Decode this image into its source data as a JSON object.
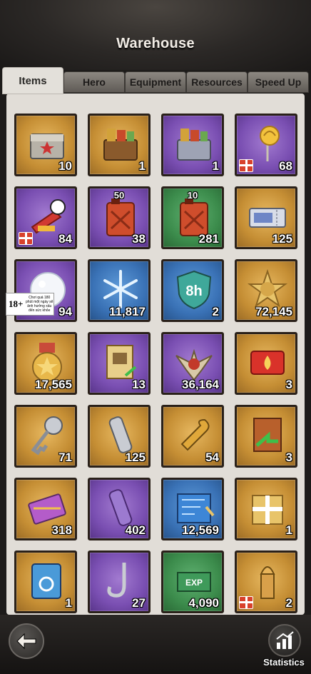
{
  "window": {
    "title": "Warehouse"
  },
  "tabs": [
    {
      "label": "Items",
      "active": true
    },
    {
      "label": "Hero",
      "active": false
    },
    {
      "label": "Equipment",
      "active": false
    },
    {
      "label": "Resources",
      "active": false
    },
    {
      "label": "Speed Up",
      "active": false
    }
  ],
  "items": [
    {
      "name": "steel-chest-icon",
      "count": "10",
      "bg": "gold"
    },
    {
      "name": "resource-chest-icon",
      "count": "1",
      "bg": "gold"
    },
    {
      "name": "silver-resource-chest-icon",
      "count": "1",
      "bg": "purple"
    },
    {
      "name": "golden-rose-icon",
      "count": "68",
      "bg": "purple",
      "gift": true
    },
    {
      "name": "air-horn-icon",
      "count": "84",
      "bg": "purple",
      "gift": true
    },
    {
      "name": "fuel-can-icon",
      "count": "38",
      "top": "50",
      "bg": "purple"
    },
    {
      "name": "fuel-can-icon",
      "count": "281",
      "top": "10",
      "bg": "green"
    },
    {
      "name": "ticket-icon",
      "count": "125",
      "bg": "gold"
    },
    {
      "name": "snowball-icon",
      "count": "94",
      "bg": "purple"
    },
    {
      "name": "snowflake-icon",
      "count": "11,817",
      "bg": "blue"
    },
    {
      "name": "shield-8h-icon",
      "count": "2",
      "bg": "blue"
    },
    {
      "name": "sheriff-badge-icon",
      "count": "72,145",
      "bg": "gold"
    },
    {
      "name": "star-medal-icon",
      "count": "17,565",
      "bg": "gold"
    },
    {
      "name": "wanted-poster-icon",
      "count": "13",
      "bg": "purple"
    },
    {
      "name": "eagle-emblem-icon",
      "count": "36,164",
      "bg": "purple"
    },
    {
      "name": "fire-card-icon",
      "count": "3",
      "bg": "gold"
    },
    {
      "name": "key-icon",
      "count": "71",
      "bg": "gold"
    },
    {
      "name": "tube-icon",
      "count": "125",
      "bg": "gold"
    },
    {
      "name": "wrench-icon",
      "count": "54",
      "bg": "gold"
    },
    {
      "name": "relocate-book-icon",
      "count": "3",
      "bg": "gold"
    },
    {
      "name": "purple-envelope-icon",
      "count": "318",
      "bg": "gold"
    },
    {
      "name": "purple-tube-icon",
      "count": "402",
      "bg": "purple"
    },
    {
      "name": "blueprint-icon",
      "count": "12,569",
      "bg": "blue"
    },
    {
      "name": "gift-crate-icon",
      "count": "1",
      "bg": "gold"
    },
    {
      "name": "blue-card-icon",
      "count": "1",
      "bg": "gold"
    },
    {
      "name": "hook-icon",
      "count": "27",
      "bg": "purple"
    },
    {
      "name": "exp-chip-icon",
      "count": "4,090",
      "bg": "green"
    },
    {
      "name": "bullet-icon",
      "count": "2",
      "bg": "gold",
      "gift": true
    }
  ],
  "ad": {
    "age": "18+",
    "text": "Chơi quá 180 phút một ngày sẽ ảnh hưởng xấu đến sức khỏe"
  },
  "bottom": {
    "statistics_label": "Statistics"
  }
}
